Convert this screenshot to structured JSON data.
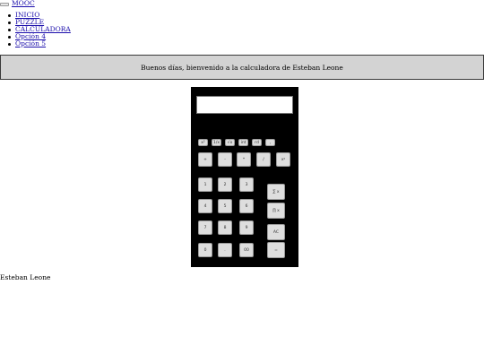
{
  "header": {
    "brand": "MOOC",
    "nav": [
      "INICIO",
      "PUZZLE",
      "CALCULADORA",
      "Opción 4",
      "Opción 5"
    ]
  },
  "banner": {
    "text": "Buenos días, bienvenido a la calculadora de Esteban Leone"
  },
  "calculator": {
    "display_value": "",
    "functions": [
      "x²",
      "1/x",
      "√x",
      "int",
      "rd",
      ","
    ],
    "operators": [
      "+",
      "-",
      "*",
      "/",
      "xʸ"
    ],
    "digits": [
      "1",
      "2",
      "3",
      "4",
      "5",
      "6",
      "7",
      "8",
      "9",
      "0",
      ".",
      "00"
    ],
    "side": [
      "∑ x",
      "∏ x",
      "AC",
      "="
    ]
  },
  "footer": {
    "text": "Esteban Leone"
  }
}
